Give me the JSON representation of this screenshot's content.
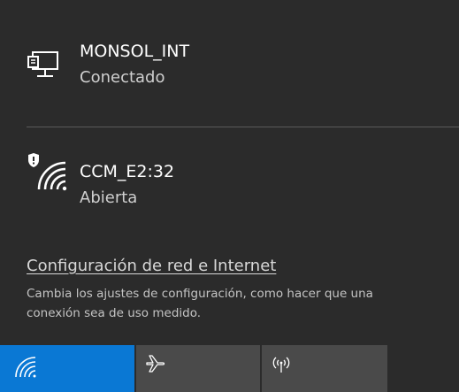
{
  "networks": [
    {
      "name": "MONSOL_INT",
      "status": "Conectado",
      "icon": "ethernet-icon"
    },
    {
      "name": "CCM_E2:32",
      "status": "Abierta",
      "icon": "wifi-unsecured-icon"
    }
  ],
  "settings": {
    "link_label": "Configuración de red e Internet",
    "description_line1": "Cambia los ajustes de configuración, como hacer que una",
    "description_line2": "conexión sea de uso medido."
  },
  "quick_actions": [
    {
      "icon": "wifi-icon",
      "active": true
    },
    {
      "icon": "airplane-icon",
      "active": false
    },
    {
      "icon": "mobile-hotspot-icon",
      "active": false
    }
  ],
  "colors": {
    "panel_background": "#2b2b2b",
    "accent": "#0a78d4",
    "tile_inactive": "#4a4a4a"
  }
}
